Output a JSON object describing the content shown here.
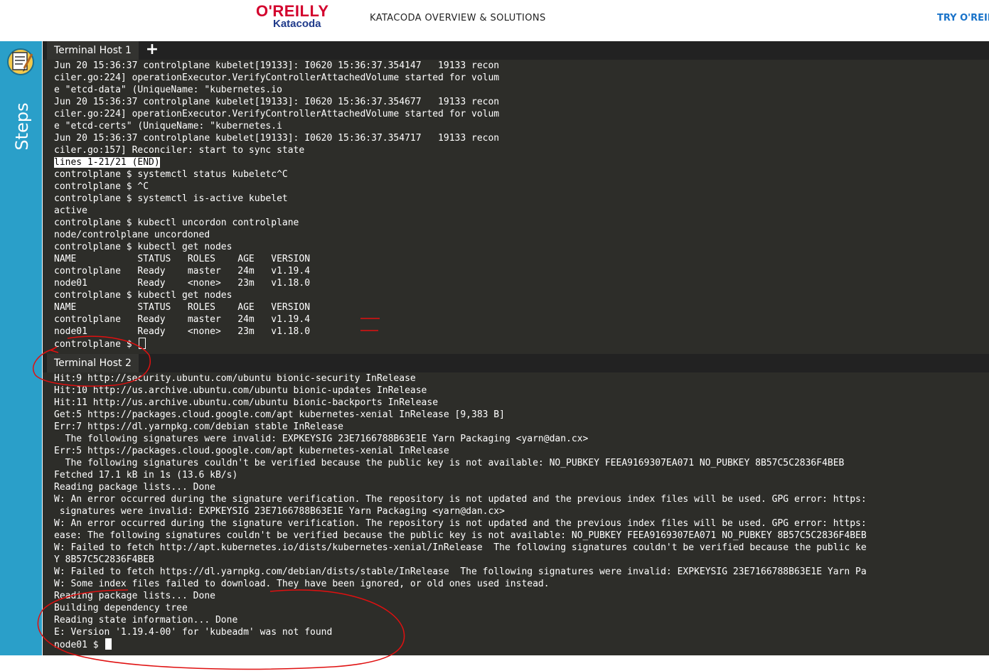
{
  "header": {
    "logo_brand": "O'REILLY",
    "logo_sub": "Katacoda",
    "nav_title": "KATACODA OVERVIEW & SOLUTIONS",
    "try_link": "TRY O'REIL"
  },
  "sidebar": {
    "label": "Steps",
    "icon": "steps-notepad-icon"
  },
  "terminal1": {
    "tab_label": "Terminal Host 1",
    "add_tab_icon": "plus-icon",
    "lines_before": [
      "Jun 20 15:36:37 controlplane kubelet[19133]: I0620 15:36:37.354147   19133 recon",
      "ciler.go:224] operationExecutor.VerifyControllerAttachedVolume started for volum",
      "e \"etcd-data\" (UniqueName: \"kubernetes.io",
      "Jun 20 15:36:37 controlplane kubelet[19133]: I0620 15:36:37.354677   19133 recon",
      "ciler.go:224] operationExecutor.VerifyControllerAttachedVolume started for volum",
      "e \"etcd-certs\" (UniqueName: \"kubernetes.i",
      "Jun 20 15:36:37 controlplane kubelet[19133]: I0620 15:36:37.354717   19133 recon",
      "ciler.go:157] Reconciler: start to sync state"
    ],
    "pager_status": "lines 1-21/21 (END)",
    "lines_after": [
      "controlplane $ systemctl status kubeletc^C",
      "controlplane $ ^C",
      "controlplane $ systemctl is-active kubelet",
      "active",
      "controlplane $ kubectl uncordon controlplane",
      "node/controlplane uncordoned",
      "controlplane $ kubectl get nodes",
      "NAME           STATUS   ROLES    AGE   VERSION",
      "controlplane   Ready    master   24m   v1.19.4",
      "node01         Ready    <none>   23m   v1.18.0",
      "controlplane $ kubectl get nodes",
      "NAME           STATUS   ROLES    AGE   VERSION",
      "controlplane   Ready    master   24m   v1.19.4",
      "node01         Ready    <none>   23m   v1.18.0"
    ],
    "prompt": "controlplane $ "
  },
  "terminal2": {
    "tab_label": "Terminal Host 2",
    "lines": [
      "Hit:9 http://security.ubuntu.com/ubuntu bionic-security InRelease",
      "Hit:10 http://us.archive.ubuntu.com/ubuntu bionic-updates InRelease",
      "Hit:11 http://us.archive.ubuntu.com/ubuntu bionic-backports InRelease",
      "Get:5 https://packages.cloud.google.com/apt kubernetes-xenial InRelease [9,383 B]",
      "Err:7 https://dl.yarnpkg.com/debian stable InRelease",
      "  The following signatures were invalid: EXPKEYSIG 23E7166788B63E1E Yarn Packaging <yarn@dan.cx>",
      "Err:5 https://packages.cloud.google.com/apt kubernetes-xenial InRelease",
      "  The following signatures couldn't be verified because the public key is not available: NO_PUBKEY FEEA9169307EA071 NO_PUBKEY 8B57C5C2836F4BEB",
      "Fetched 17.1 kB in 1s (13.6 kB/s)",
      "Reading package lists... Done",
      "W: An error occurred during the signature verification. The repository is not updated and the previous index files will be used. GPG error: https:",
      " signatures were invalid: EXPKEYSIG 23E7166788B63E1E Yarn Packaging <yarn@dan.cx>",
      "W: An error occurred during the signature verification. The repository is not updated and the previous index files will be used. GPG error: https:",
      "ease: The following signatures couldn't be verified because the public key is not available: NO_PUBKEY FEEA9169307EA071 NO_PUBKEY 8B57C5C2836F4BEB",
      "W: Failed to fetch http://apt.kubernetes.io/dists/kubernetes-xenial/InRelease  The following signatures couldn't be verified because the public ke",
      "Y 8B57C5C2836F4BEB",
      "W: Failed to fetch https://dl.yarnpkg.com/debian/dists/stable/InRelease  The following signatures were invalid: EXPKEYSIG 23E7166788B63E1E Yarn Pa",
      "W: Some index files failed to download. They have been ignored, or old ones used instead.",
      "Reading package lists... Done",
      "Building dependency tree",
      "Reading state information... Done",
      "E: Version '1.19.4-00' for 'kubeadm' was not found"
    ],
    "prompt": "node01 $ "
  },
  "colors": {
    "sidebar": "#2a9fc9",
    "terminal_bg": "#2d2d29",
    "tabbar_bg": "#222222",
    "annotation_red": "#e01010",
    "brand_red": "#d3002d",
    "link_blue": "#1a73c9"
  }
}
